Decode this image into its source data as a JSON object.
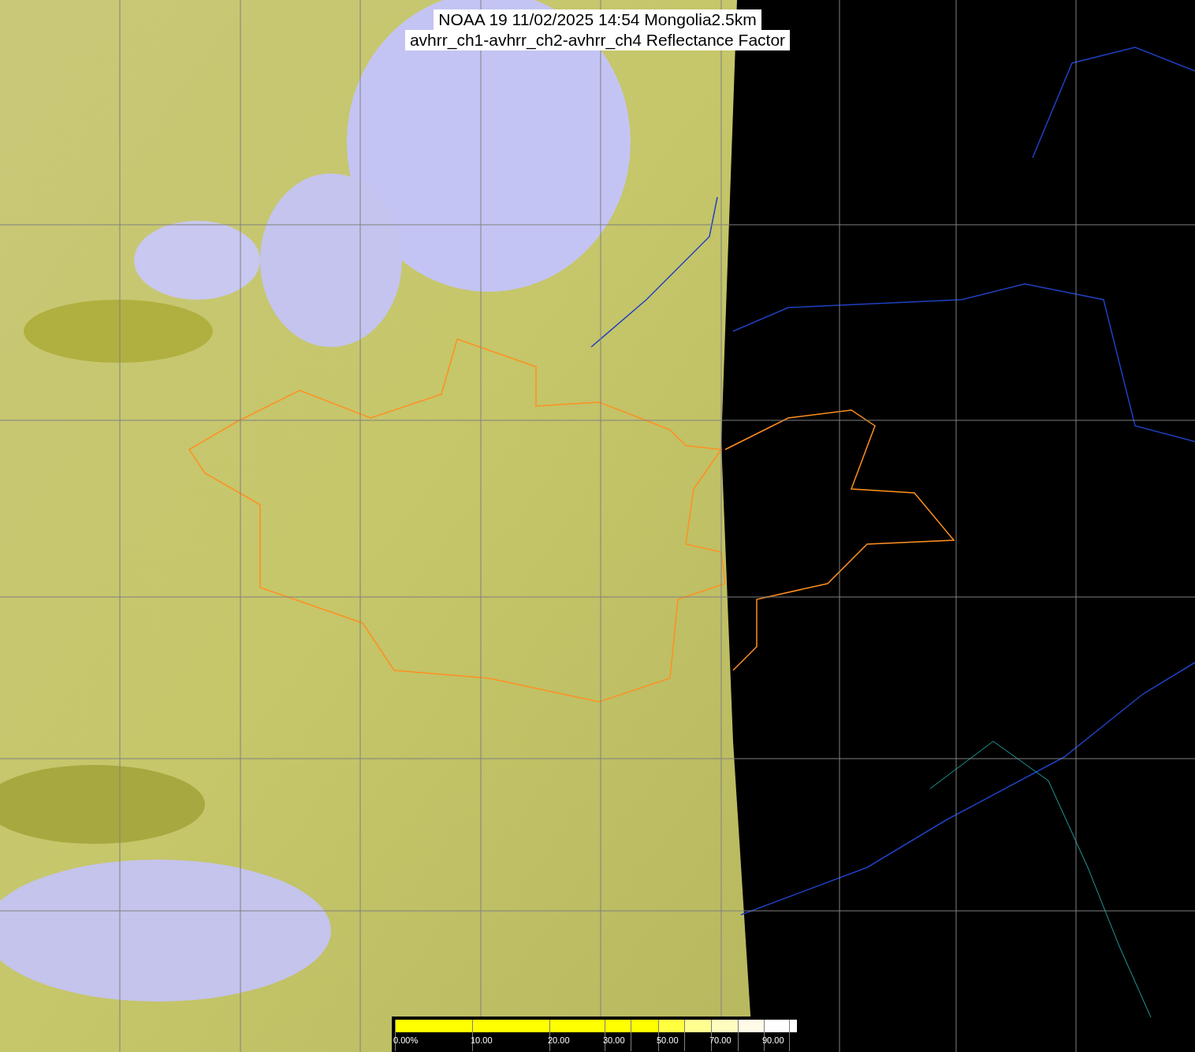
{
  "title": {
    "lines": [
      "NOAA 19 11/02/2025 14:54 Mongolia2.5km",
      "avhrr_ch1-avhrr_ch2-avhrr_ch4 Reflectance Factor"
    ]
  },
  "legend": {
    "segments": [
      {
        "color": "#ffff00",
        "label": "0.00%"
      },
      {
        "color": "#ffff00",
        "label": "10.00"
      },
      {
        "color": "#ffff00",
        "label": "20.00"
      },
      {
        "color": "#ffff00",
        "label": "30.00"
      },
      {
        "color": "#ffff00"
      },
      {
        "color": "#ffff40",
        "label": "50.00"
      },
      {
        "color": "#ffff90"
      },
      {
        "color": "#fffcc0",
        "label": "70.00"
      },
      {
        "color": "#fffbe6"
      },
      {
        "color": "#ffffff",
        "label": "90.00"
      },
      {
        "color": "#ffffff"
      }
    ]
  }
}
